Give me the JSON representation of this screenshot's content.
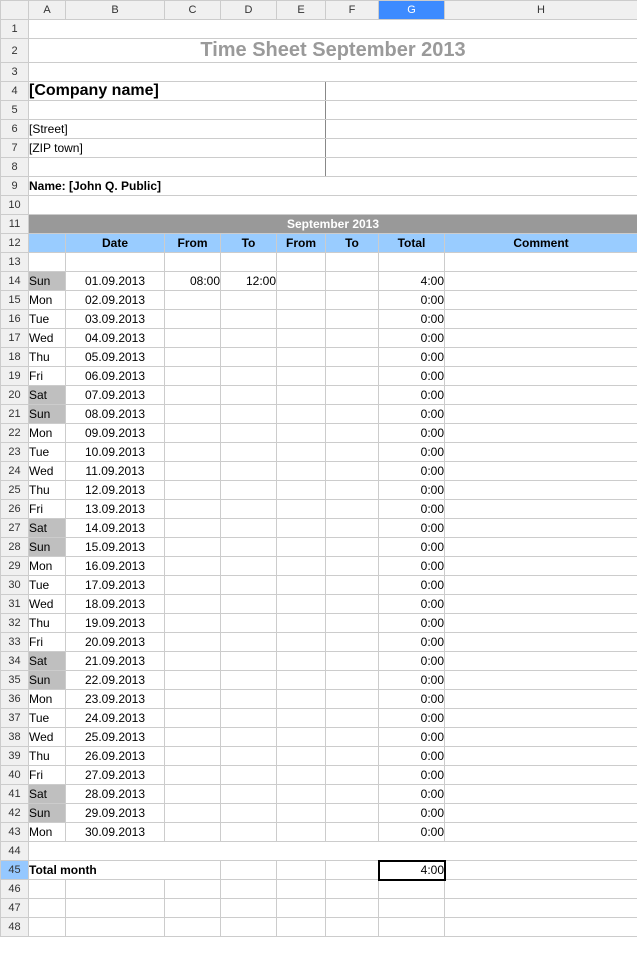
{
  "columns": [
    "A",
    "B",
    "C",
    "D",
    "E",
    "F",
    "G",
    "H"
  ],
  "selected_col": "G",
  "selected_row": 45,
  "title": "Time Sheet September 2013",
  "company": "[Company name]",
  "street": "[Street]",
  "zip": "[ZIP town]",
  "name_line": "Name: [John Q. Public]",
  "month_header": "September 2013",
  "headers": {
    "date": "Date",
    "from": "From",
    "to": "To",
    "from2": "From",
    "to2": "To",
    "total": "Total",
    "comment": "Comment"
  },
  "rows": [
    {
      "r": 14,
      "day": "Sun",
      "date": "01.09.2013",
      "from": "08:00",
      "to": "12:00",
      "total": "4:00",
      "wkend": true
    },
    {
      "r": 15,
      "day": "Mon",
      "date": "02.09.2013",
      "from": "",
      "to": "",
      "total": "0:00",
      "wkend": false
    },
    {
      "r": 16,
      "day": "Tue",
      "date": "03.09.2013",
      "from": "",
      "to": "",
      "total": "0:00",
      "wkend": false
    },
    {
      "r": 17,
      "day": "Wed",
      "date": "04.09.2013",
      "from": "",
      "to": "",
      "total": "0:00",
      "wkend": false
    },
    {
      "r": 18,
      "day": "Thu",
      "date": "05.09.2013",
      "from": "",
      "to": "",
      "total": "0:00",
      "wkend": false
    },
    {
      "r": 19,
      "day": "Fri",
      "date": "06.09.2013",
      "from": "",
      "to": "",
      "total": "0:00",
      "wkend": false
    },
    {
      "r": 20,
      "day": "Sat",
      "date": "07.09.2013",
      "from": "",
      "to": "",
      "total": "0:00",
      "wkend": true
    },
    {
      "r": 21,
      "day": "Sun",
      "date": "08.09.2013",
      "from": "",
      "to": "",
      "total": "0:00",
      "wkend": true
    },
    {
      "r": 22,
      "day": "Mon",
      "date": "09.09.2013",
      "from": "",
      "to": "",
      "total": "0:00",
      "wkend": false
    },
    {
      "r": 23,
      "day": "Tue",
      "date": "10.09.2013",
      "from": "",
      "to": "",
      "total": "0:00",
      "wkend": false
    },
    {
      "r": 24,
      "day": "Wed",
      "date": "11.09.2013",
      "from": "",
      "to": "",
      "total": "0:00",
      "wkend": false
    },
    {
      "r": 25,
      "day": "Thu",
      "date": "12.09.2013",
      "from": "",
      "to": "",
      "total": "0:00",
      "wkend": false
    },
    {
      "r": 26,
      "day": "Fri",
      "date": "13.09.2013",
      "from": "",
      "to": "",
      "total": "0:00",
      "wkend": false
    },
    {
      "r": 27,
      "day": "Sat",
      "date": "14.09.2013",
      "from": "",
      "to": "",
      "total": "0:00",
      "wkend": true
    },
    {
      "r": 28,
      "day": "Sun",
      "date": "15.09.2013",
      "from": "",
      "to": "",
      "total": "0:00",
      "wkend": true
    },
    {
      "r": 29,
      "day": "Mon",
      "date": "16.09.2013",
      "from": "",
      "to": "",
      "total": "0:00",
      "wkend": false
    },
    {
      "r": 30,
      "day": "Tue",
      "date": "17.09.2013",
      "from": "",
      "to": "",
      "total": "0:00",
      "wkend": false
    },
    {
      "r": 31,
      "day": "Wed",
      "date": "18.09.2013",
      "from": "",
      "to": "",
      "total": "0:00",
      "wkend": false
    },
    {
      "r": 32,
      "day": "Thu",
      "date": "19.09.2013",
      "from": "",
      "to": "",
      "total": "0:00",
      "wkend": false
    },
    {
      "r": 33,
      "day": "Fri",
      "date": "20.09.2013",
      "from": "",
      "to": "",
      "total": "0:00",
      "wkend": false
    },
    {
      "r": 34,
      "day": "Sat",
      "date": "21.09.2013",
      "from": "",
      "to": "",
      "total": "0:00",
      "wkend": true
    },
    {
      "r": 35,
      "day": "Sun",
      "date": "22.09.2013",
      "from": "",
      "to": "",
      "total": "0:00",
      "wkend": true
    },
    {
      "r": 36,
      "day": "Mon",
      "date": "23.09.2013",
      "from": "",
      "to": "",
      "total": "0:00",
      "wkend": false
    },
    {
      "r": 37,
      "day": "Tue",
      "date": "24.09.2013",
      "from": "",
      "to": "",
      "total": "0:00",
      "wkend": false
    },
    {
      "r": 38,
      "day": "Wed",
      "date": "25.09.2013",
      "from": "",
      "to": "",
      "total": "0:00",
      "wkend": false
    },
    {
      "r": 39,
      "day": "Thu",
      "date": "26.09.2013",
      "from": "",
      "to": "",
      "total": "0:00",
      "wkend": false
    },
    {
      "r": 40,
      "day": "Fri",
      "date": "27.09.2013",
      "from": "",
      "to": "",
      "total": "0:00",
      "wkend": false
    },
    {
      "r": 41,
      "day": "Sat",
      "date": "28.09.2013",
      "from": "",
      "to": "",
      "total": "0:00",
      "wkend": true
    },
    {
      "r": 42,
      "day": "Sun",
      "date": "29.09.2013",
      "from": "",
      "to": "",
      "total": "0:00",
      "wkend": true
    },
    {
      "r": 43,
      "day": "Mon",
      "date": "30.09.2013",
      "from": "",
      "to": "",
      "total": "0:00",
      "wkend": false
    }
  ],
  "total_month_label": "Total month",
  "total_month_value": "4:00",
  "blank_rows": [
    46,
    47,
    48
  ]
}
